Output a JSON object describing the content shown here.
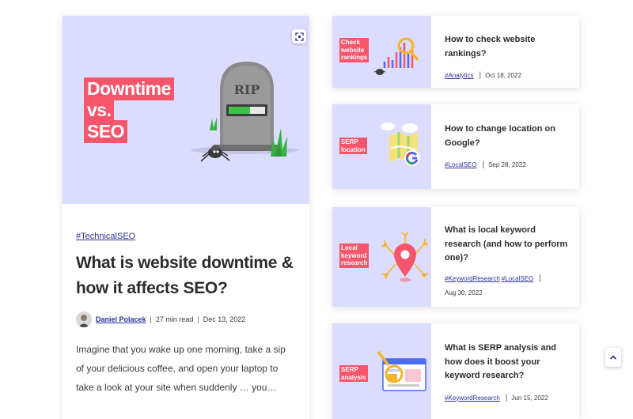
{
  "featured": {
    "image_lines": [
      "Downtime",
      "vs.",
      "SEO"
    ],
    "tombstone_text": "RIP",
    "tag": "#TechnicalSEO",
    "title": "What is website downtime & how it affects SEO?",
    "author": "Daniel Polacek",
    "read_time": "27 min read",
    "date": "Dec 13, 2022",
    "excerpt": "Imagine that you wake up one morning, take a sip of your delicious coffee, and open your laptop to take a look at your site when suddenly … you…"
  },
  "articles": [
    {
      "badge_lines": [
        "Check",
        "website",
        "rankings"
      ],
      "title": "How to check website rankings?",
      "tags": [
        "#Analytics"
      ],
      "date": "Oct 18, 2022"
    },
    {
      "badge_lines": [
        "SERP",
        "location"
      ],
      "title": "How to change location on Google?",
      "tags": [
        "#LocalSEO"
      ],
      "date": "Sep 28, 2022"
    },
    {
      "badge_lines": [
        "Local",
        "keyword",
        "research"
      ],
      "title": "What is local keyword research (and how to perform one)?",
      "tags": [
        "#KeywordResearch",
        "#LocalSEO"
      ],
      "date": "Aug 30, 2022"
    },
    {
      "badge_lines": [
        "SERP",
        "analysis"
      ],
      "title": "What is SERP analysis and how does it boost your keyword research?",
      "tags": [
        "#KeywordResearch"
      ],
      "date": "Jun 15, 2022"
    }
  ],
  "colors": {
    "accent_red": "#f5566b",
    "lavender": "#dcdcff",
    "link_blue": "#2f2f9d"
  }
}
